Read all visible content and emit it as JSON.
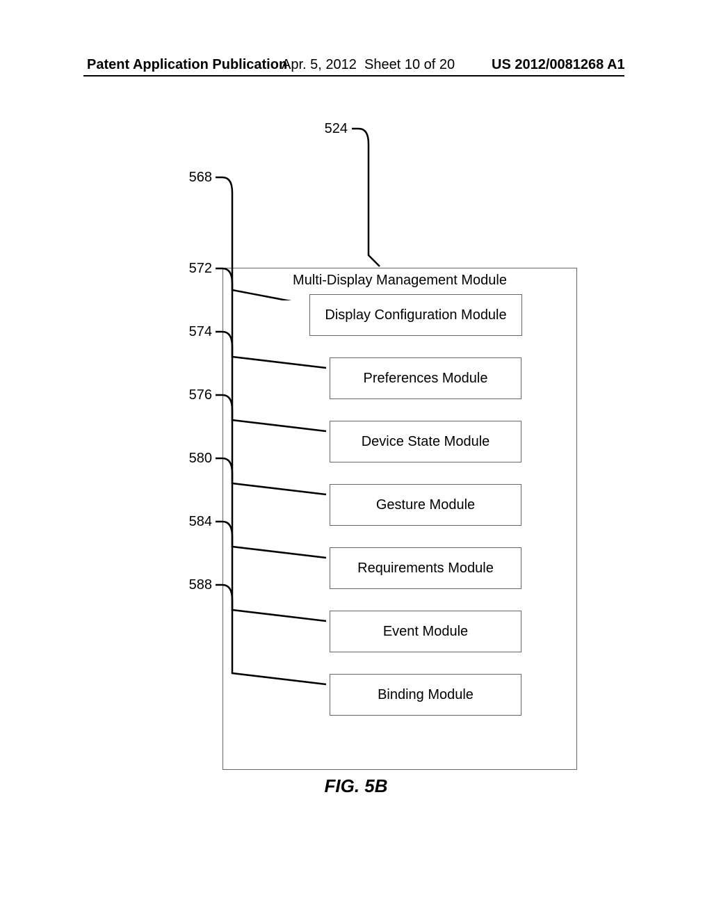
{
  "header": {
    "left": "Patent Application Publication",
    "date": "Apr. 5, 2012",
    "sheet": "Sheet 10 of 20",
    "pubno": "US 2012/0081268 A1"
  },
  "figure": {
    "caption": "FIG. 5B",
    "outer": {
      "ref": "524",
      "title": "Multi-Display Management Module"
    },
    "modules": [
      {
        "ref": "568",
        "label": "Display Configuration Module"
      },
      {
        "ref": "572",
        "label": "Preferences Module"
      },
      {
        "ref": "574",
        "label": "Device State Module"
      },
      {
        "ref": "576",
        "label": "Gesture Module"
      },
      {
        "ref": "580",
        "label": "Requirements Module"
      },
      {
        "ref": "584",
        "label": "Event Module"
      },
      {
        "ref": "588",
        "label": "Binding Module"
      }
    ]
  }
}
